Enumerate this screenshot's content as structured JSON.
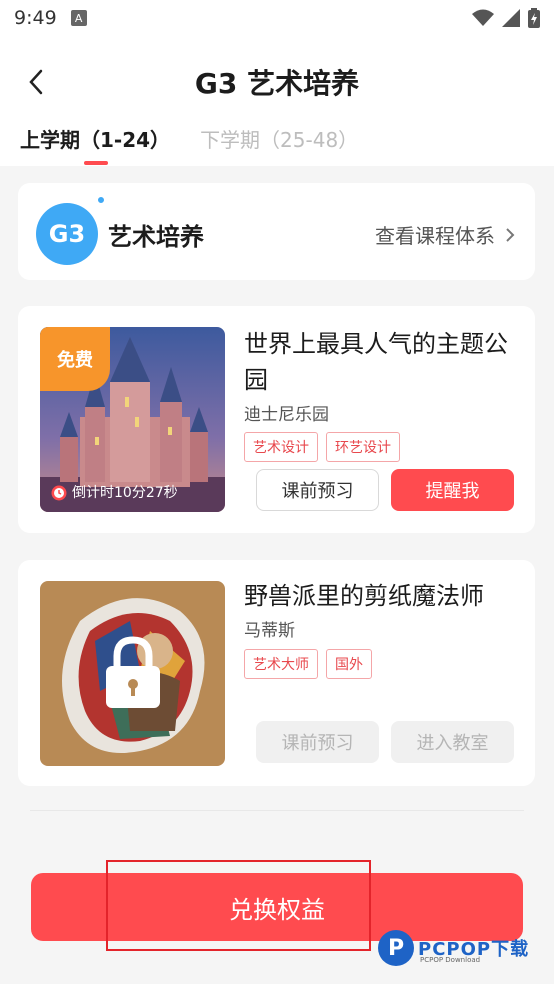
{
  "status_bar": {
    "time": "9:49",
    "sim_badge": "A"
  },
  "header": {
    "title": "G3 艺术培养",
    "tabs": [
      {
        "label": "上学期（1-24）",
        "active": true
      },
      {
        "label": "下学期（25-48）",
        "active": false
      }
    ]
  },
  "course": {
    "badge": "G3",
    "name": "艺术培养",
    "link_label": "查看课程体系"
  },
  "lessons": [
    {
      "title": "世界上最具人气的主题公园",
      "author": "迪士尼乐园",
      "tags": [
        "艺术设计",
        "环艺设计"
      ],
      "free_tag": "免费",
      "countdown": "倒计时10分27秒",
      "buttons": [
        "课前预习",
        "提醒我"
      ],
      "locked": false
    },
    {
      "title": "野兽派里的剪纸魔法师",
      "author": "马蒂斯",
      "tags": [
        "艺术大师",
        "国外"
      ],
      "buttons": [
        "课前预习",
        "进入教室"
      ],
      "locked": true
    }
  ],
  "footer": {
    "redeem_label": "兑换权益"
  },
  "watermark": {
    "logo": "P",
    "text": "PCPOP下载",
    "sub": "PCPOP Download"
  },
  "colors": {
    "accent": "#ff4b4f",
    "badge_blue": "#3fa9f5",
    "free_orange": "#f7952b"
  }
}
